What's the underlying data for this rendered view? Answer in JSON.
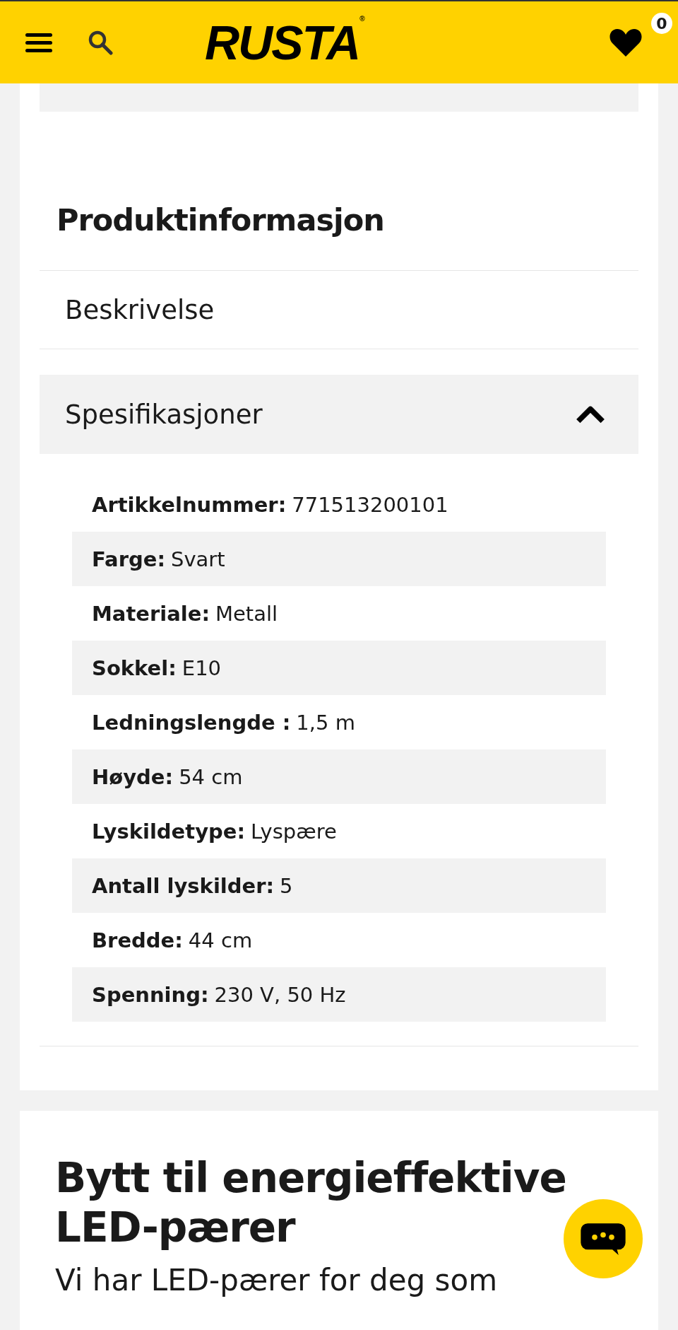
{
  "header": {
    "logo": "RUSTA",
    "logo_mark": "®",
    "favorites_count": "0"
  },
  "product_info": {
    "title": "Produktinformasjon",
    "sections": [
      {
        "label": "Beskrivelse",
        "expanded": false
      },
      {
        "label": "Spesifikasjoner",
        "expanded": true
      }
    ],
    "specs": [
      {
        "label": "Artikkelnummer:",
        "value": "771513200101"
      },
      {
        "label": "Farge:",
        "value": "Svart"
      },
      {
        "label": "Materiale:",
        "value": "Metall"
      },
      {
        "label": "Sokkel:",
        "value": "E10"
      },
      {
        "label": "Ledningslengde :",
        "value": "1,5 m"
      },
      {
        "label": "Høyde:",
        "value": "54 cm"
      },
      {
        "label": "Lyskildetype:",
        "value": "Lyspære"
      },
      {
        "label": "Antall lyskilder:",
        "value": "5"
      },
      {
        "label": "Bredde:",
        "value": "44 cm"
      },
      {
        "label": "Spenning:",
        "value": "230 V, 50 Hz"
      }
    ]
  },
  "promo": {
    "heading": "Bytt til energieffektive LED-pærer",
    "text": "Vi har LED-pærer for deg som"
  }
}
